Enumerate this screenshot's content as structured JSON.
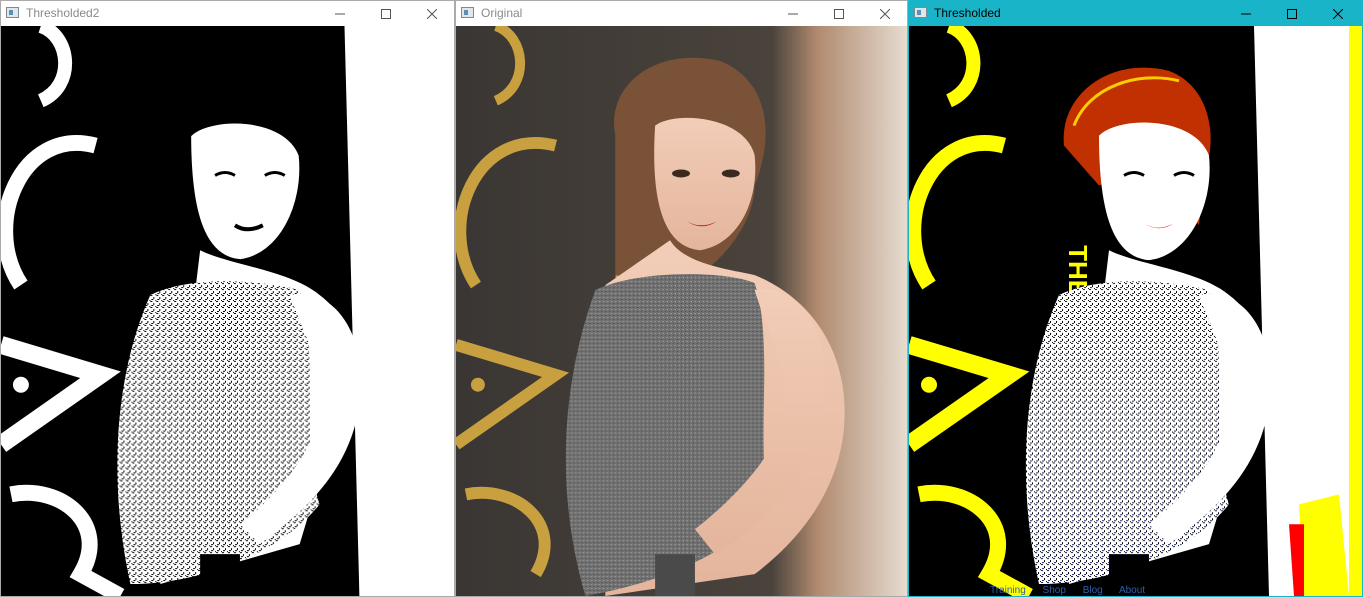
{
  "windows": [
    {
      "title": "Thresholded2",
      "state": "inactive",
      "style": "binary"
    },
    {
      "title": "Original",
      "state": "inactive",
      "style": "photo"
    },
    {
      "title": "Thresholded",
      "state": "active",
      "style": "color-threshold"
    }
  ],
  "controls": {
    "minimize": "minimize-icon",
    "maximize": "maximize-icon",
    "close": "close-icon"
  },
  "colors": {
    "active_titlebar": "#19b4c8",
    "threshold_yellow": "#ffff00",
    "threshold_red": "#ff0000",
    "dress_gray": "#6e6e6e",
    "backdrop_gold": "#c8a040"
  },
  "background_menu": [
    "Training",
    "Shop",
    "Blog",
    "About"
  ]
}
